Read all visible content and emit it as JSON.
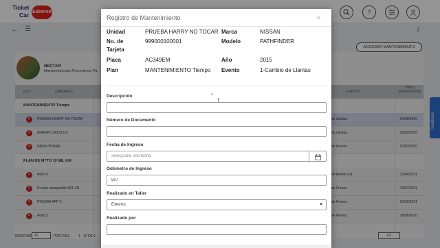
{
  "app": {
    "logo": {
      "line1": "Ticket",
      "line2": "Car",
      "brand": "Edenred"
    },
    "add_button": "AGREGAR MANTENIMIENTO",
    "feedback": "Feedback",
    "vehicle": {
      "name": "NECTAR",
      "subtitle": "Mantenimientos Preventivos Pa"
    },
    "table_headers": {
      "status": "EST...",
      "unit": "UNIDADES",
      "event": "EVENTO",
      "last": "Último Mantenimiento"
    },
    "groups": [
      {
        "title": "MANTENIMIENTO Tiempo",
        "rows": [
          {
            "name": "PRUEBA HARRY NO TOCAR",
            "event": "de Llantas",
            "date": "01/09/2020"
          },
          {
            "name": "ADRIAN CASTILLO",
            "event": "de Llantas",
            "date": "20/02/2020"
          },
          {
            "name": "GRAN VITARA",
            "event": "de Frenos",
            "date": "01/02/2020"
          }
        ]
      },
      {
        "title": "PLAN DE MTTO 10 MIL KM",
        "rows": [
          {
            "name": "AG014",
            "event": "de Aceite Full",
            "date": "23/04/2021"
          },
          {
            "name": "Prueba autogestión 001 LM",
            "event": "de Frenos",
            "date": "24/07/2021"
          },
          {
            "name": "PRUEBA APP 3",
            "event": "de Frenos",
            "date": "01/02/2021"
          },
          {
            "name": "AG013",
            "event": "de Frenos",
            "date": "26/05/2020"
          }
        ]
      }
    ],
    "footer": {
      "show": "MOSTRAR",
      "per_page_value": "10",
      "per_page_suffix": "POR PÁG.",
      "range": "1 - 10 DE 1",
      "page": "1/1"
    }
  },
  "modal": {
    "title": "Registro de Mantenimiento",
    "close": "×",
    "info": {
      "unidad_label": "Unidad",
      "unidad_value": "PRUEBA HARRY NO TOCAR",
      "marca_label": "Marca",
      "marca_value": "NISSAN",
      "tarjeta_label_1": "No. de",
      "tarjeta_label_2": "Tarjeta",
      "tarjeta_value": "999000100001",
      "modelo_label": "Modelo",
      "modelo_value": "PATHFINDER",
      "placa_label": "Placa",
      "placa_value": "AC349EM",
      "anio_label": "Año",
      "anio_value": "2015",
      "plan_label": "Plan",
      "plan_value": "MANTENIMIENTO Tiempo",
      "evento_label": "Evento",
      "evento_value": "1-Cambio de Llantas"
    },
    "required_mark": "*",
    "fields": {
      "descripcion_label": "Descripción",
      "descripcion_value": "",
      "documento_label": "Número de Documento",
      "documento_value": "",
      "fecha_label": "Fecha de Ingreso",
      "fecha_placeholder": "Seleccione una fecha",
      "odometro_label": "Odómetro de Ingreso",
      "odometro_value": "507",
      "taller_label": "Realizado en Taller",
      "taller_value": "Externo",
      "realizado_label": "Realizado por",
      "realizado_value": ""
    }
  }
}
